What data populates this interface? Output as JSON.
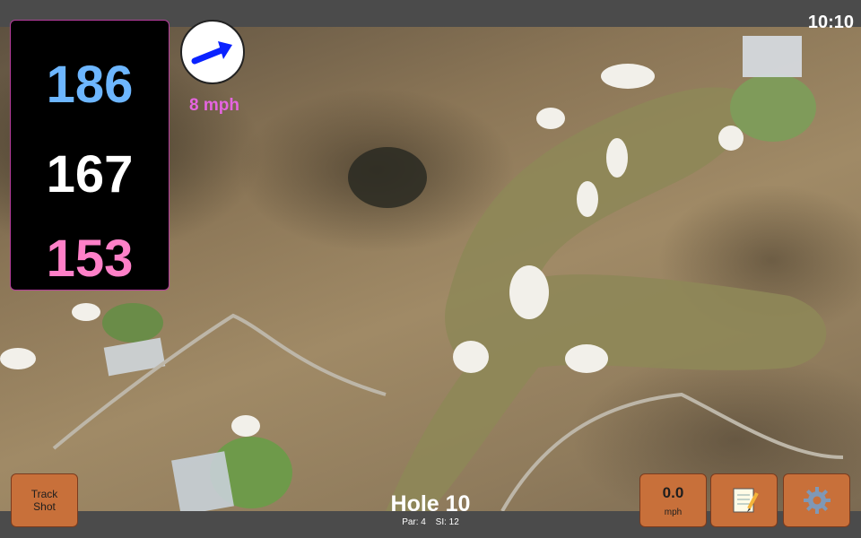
{
  "status": {
    "time": "10:10"
  },
  "distances": {
    "back": "186",
    "middle": "167",
    "front": "153"
  },
  "wind": {
    "speed": "8 mph",
    "arrow_color": "#0a22ff"
  },
  "hole": {
    "title": "Hole 10",
    "par": "Par: 4",
    "stroke_index": "SI: 12"
  },
  "buttons": {
    "track_shot": "Track\nShot",
    "speed_value": "0.0",
    "speed_unit": "mph",
    "notes_icon": "notepad-icon",
    "settings_icon": "gear-icon"
  },
  "colors": {
    "back": "#6db6ff",
    "middle": "#ffffff",
    "front": "#ff80c8",
    "button": "#c8703a",
    "panel_border": "#b43d9b"
  }
}
